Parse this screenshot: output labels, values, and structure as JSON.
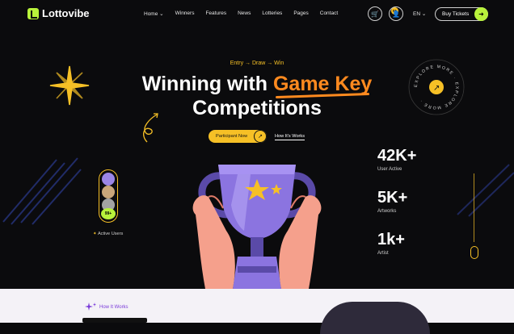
{
  "brand": {
    "name": "Lottovibe"
  },
  "nav": {
    "items": [
      "Home",
      "Winners",
      "Features",
      "News",
      "Lotteries",
      "Pages",
      "Contact"
    ],
    "cart_count": "01",
    "language": "EN",
    "buy_label": "Buy Tickets"
  },
  "hero": {
    "eyebrow": "Entry → Draw → Win",
    "title_part1": "Winning with ",
    "title_accent": "Game Key",
    "title_line2": "Competitions",
    "cta_label": "Participant Now",
    "secondary_link": "How It's Works",
    "explore_text": "EXPLORE MORE · EXPLORE MORE ·"
  },
  "stats": [
    {
      "value": "42K+",
      "label": "User Active"
    },
    {
      "value": "5K+",
      "label": "Artworks"
    },
    {
      "value": "1k+",
      "label": "Artist"
    }
  ],
  "active_users": {
    "count": "99+",
    "label": "Active Users"
  },
  "next_section": {
    "eyebrow": "How It Works"
  },
  "colors": {
    "accent_green": "#b8f23b",
    "accent_yellow": "#f6c026",
    "accent_orange": "#ff8a1f",
    "bg": "#0b0b0d"
  }
}
